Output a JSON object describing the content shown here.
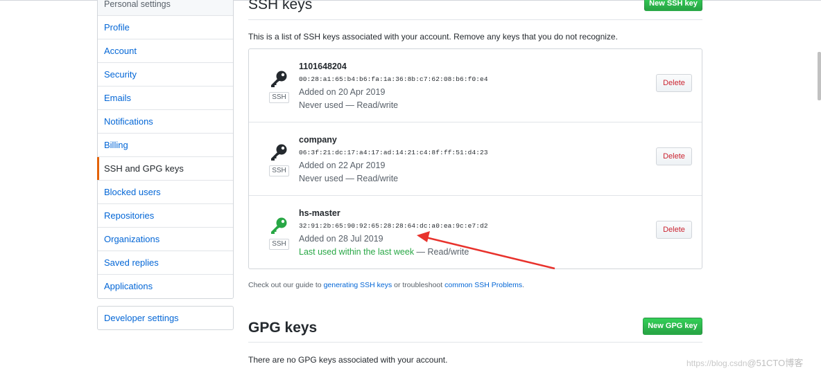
{
  "sidebar": {
    "header": "Personal settings",
    "items": [
      {
        "label": "Profile"
      },
      {
        "label": "Account"
      },
      {
        "label": "Security"
      },
      {
        "label": "Emails"
      },
      {
        "label": "Notifications"
      },
      {
        "label": "Billing"
      },
      {
        "label": "SSH and GPG keys",
        "selected": true
      },
      {
        "label": "Blocked users"
      },
      {
        "label": "Repositories"
      },
      {
        "label": "Organizations"
      },
      {
        "label": "Saved replies"
      },
      {
        "label": "Applications"
      }
    ],
    "developer": "Developer settings"
  },
  "ssh": {
    "title": "SSH keys",
    "new_button": "New SSH key",
    "intro": "This is a list of SSH keys associated with your account. Remove any keys that you do not recognize.",
    "keys": [
      {
        "title": "1101648204",
        "fingerprint": "00:28:a1:65:b4:b6:fa:1a:36:8b:c7:62:08:b6:f0:e4",
        "added": "Added on 20 Apr 2019",
        "used": "Never used",
        "access": " — Read/write",
        "icon": "key-icon",
        "icon_color": "#24292e",
        "badge": "SSH",
        "delete": "Delete"
      },
      {
        "title": "company",
        "fingerprint": "06:3f:21:dc:17:a4:17:ad:14:21:c4:8f:ff:51:d4:23",
        "added": "Added on 22 Apr 2019",
        "used": "Never used",
        "access": " — Read/write",
        "icon": "key-icon",
        "icon_color": "#24292e",
        "badge": "SSH",
        "delete": "Delete"
      },
      {
        "title": "hs-master",
        "fingerprint": "32:91:2b:65:90:92:65:28:28:64:dc:a0:ea:9c:e7:d2",
        "added": "Added on 28 Jul 2019",
        "used": "Last used within the last week",
        "access": " — Read/write",
        "icon": "key-icon",
        "icon_color": "#28a745",
        "badge": "SSH",
        "delete": "Delete"
      }
    ],
    "guide": {
      "prefix": "Check out our guide to ",
      "link1": "generating SSH keys",
      "middle": " or troubleshoot ",
      "link2": "common SSH Problems",
      "suffix": "."
    }
  },
  "gpg": {
    "title": "GPG keys",
    "new_button": "New GPG key",
    "empty": "There are no GPG keys associated with your account."
  },
  "watermark": {
    "url": "https://blog.csdn",
    "brand": "@51CTO博客"
  },
  "colors": {
    "accent": "#e36209",
    "link": "#0366d6",
    "green": "#28a745",
    "danger": "#cb2431",
    "annotation_arrow": "#e8322c"
  }
}
